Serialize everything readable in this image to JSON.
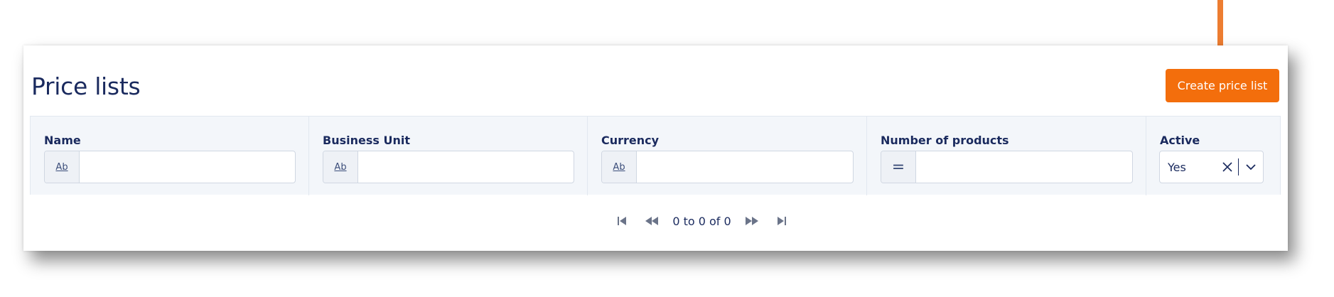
{
  "header": {
    "title": "Price lists",
    "create_button_label": "Create price list"
  },
  "filters": [
    {
      "label": "Name",
      "type_chip": "Ab",
      "value": ""
    },
    {
      "label": "Business Unit",
      "type_chip": "Ab",
      "value": ""
    },
    {
      "label": "Currency",
      "type_chip": "Ab",
      "value": ""
    },
    {
      "label": "Number of products",
      "type_chip": "=",
      "value": ""
    },
    {
      "label": "Active",
      "selected": "Yes"
    }
  ],
  "pagination": {
    "summary": "0 to 0 of 0"
  },
  "colors": {
    "accent": "#f36e0c",
    "text": "#1a2a5e",
    "filter_bg": "#f3f6fa",
    "arrow": "#ed7d31"
  },
  "icons": {
    "arrow": "arrow-down-icon",
    "clear": "close-icon",
    "dropdown": "chevron-down-icon",
    "first": "page-first-icon",
    "prev": "page-prev-icon",
    "next": "page-next-icon",
    "last": "page-last-icon"
  }
}
